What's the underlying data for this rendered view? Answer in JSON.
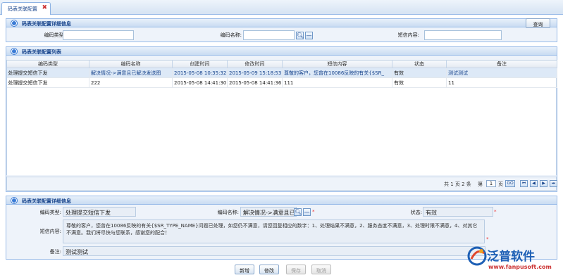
{
  "tab": {
    "title": "码表关联配置",
    "close": "✖"
  },
  "search_panel": {
    "title": "码表关联配置详细信息",
    "code_type_label": "编码类型:",
    "code_name_label": "编码名称:",
    "sms_content_label": "短信内容:",
    "code_type_value": "",
    "code_name_value": "",
    "sms_content_value": "",
    "search_button": "查询"
  },
  "list_panel": {
    "title": "码表关联配置列表",
    "columns": [
      "编码类型",
      "编码名称",
      "创建时间",
      "修改时间",
      "短信内容",
      "状态",
      "备注"
    ],
    "rows": [
      [
        "处理提交短信下发",
        "解决情况->满意且已解决发送图",
        "2015-05-08 10:35:32",
        "2015-05-09 15:18:53",
        "尊敬的客户，您曾在10086反映的有关{$SR_",
        "有效",
        "测试测试"
      ],
      [
        "处理提交短信下发",
        "222",
        "2015-05-08 14:41:30",
        "2015-05-08 14:41:36",
        "111",
        "有效",
        "11"
      ]
    ],
    "pager": {
      "total_pages_text": "共 1 页 2 条",
      "page_prefix": "第",
      "page_input": "1",
      "page_suffix": "页",
      "go": "GO",
      "first": "⏮",
      "prev": "◀",
      "next": "▶",
      "last": "⏭"
    }
  },
  "detail_panel": {
    "title": "码表关联配置详细信息",
    "code_type_label": "编码类型:",
    "code_type_value": "处理提交短信下发",
    "code_name_label": "编码名称:",
    "code_name_value": "解决情况->满意且已",
    "status_label": "状态:",
    "status_value": "有效",
    "sms_content_label": "短信内容:",
    "sms_content_value": "尊敬的客户，您曾在10086反映的有关{$SR_TYPE_NAME}问题已处理，如您仍不满意，请您回复相应的数字：1、处理结果不满意，2、服务态度不满意，3、处理时限不满意，4、对其它不满意。我们将尽快与您联系，感谢您的配合！",
    "remark_label": "备注:",
    "remark_value": "测试测试",
    "required_mark": "*"
  },
  "actions": {
    "add": "新增",
    "edit": "修改",
    "save": "保存",
    "cancel": "取消"
  },
  "logo": {
    "name": "泛普软件",
    "url": "www.fanpusoft.com"
  }
}
